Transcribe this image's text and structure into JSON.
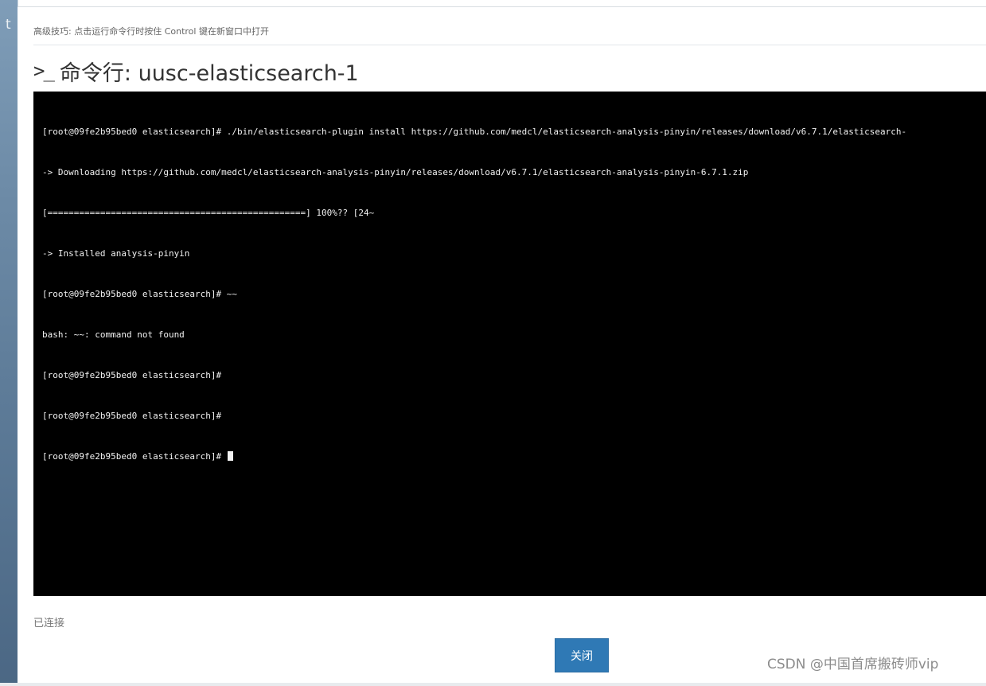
{
  "tip": "高级技巧: 点击运行命令行时按住 Control 键在新窗口中打开",
  "header": {
    "icon": "terminal-icon",
    "icon_glyph": ">_",
    "title": "命令行: uusc-elasticsearch-1"
  },
  "terminal": {
    "lines": [
      "[root@09fe2b95bed0 elasticsearch]# ./bin/elasticsearch-plugin install https://github.com/medcl/elasticsearch-analysis-pinyin/releases/download/v6.7.1/elasticsearch-",
      "-> Downloading https://github.com/medcl/elasticsearch-analysis-pinyin/releases/download/v6.7.1/elasticsearch-analysis-pinyin-6.7.1.zip",
      "[=================================================] 100%?? [24~",
      "-> Installed analysis-pinyin",
      "[root@09fe2b95bed0 elasticsearch]# ~~",
      "bash: ~~: command not found",
      "[root@09fe2b95bed0 elasticsearch]#",
      "[root@09fe2b95bed0 elasticsearch]#",
      "[root@09fe2b95bed0 elasticsearch]# "
    ]
  },
  "status": "已连接",
  "close_button": "关闭",
  "watermark": "CSDN @中国首席搬砖师vip",
  "colors": {
    "terminal_bg": "#000000",
    "terminal_fg": "#f2f2f2",
    "button_bg": "#2f79b5",
    "strip": "#6d8ba7"
  }
}
